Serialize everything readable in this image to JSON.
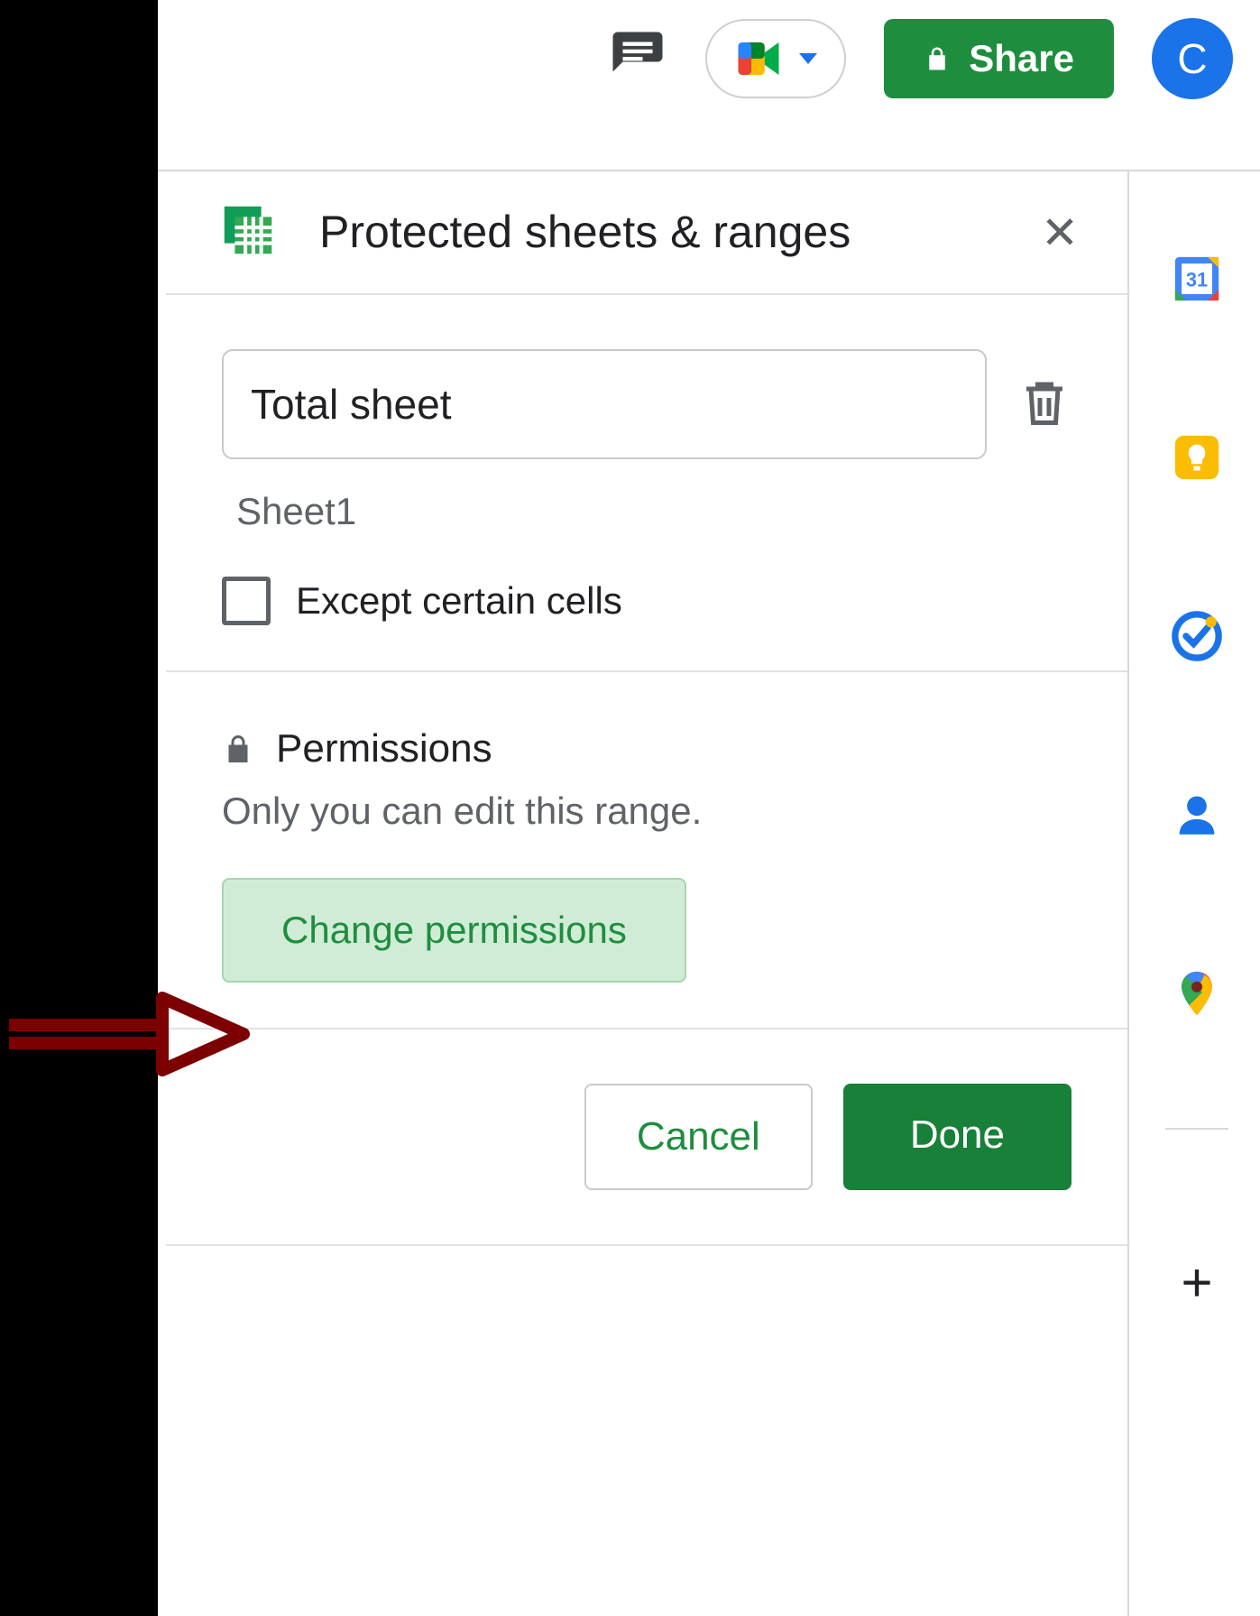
{
  "topbar": {
    "share_label": "Share",
    "avatar_initial": "C"
  },
  "panel": {
    "title": "Protected sheets & ranges",
    "protection_name": "Total sheet",
    "sub_sheet_label": "Sheet1",
    "except_cells_label": "Except certain cells",
    "permissions_heading": "Permissions",
    "permissions_desc": "Only you can edit this range.",
    "change_permissions_label": "Change permissions",
    "cancel_label": "Cancel",
    "done_label": "Done"
  },
  "rightrail": {
    "calendar_day": "31"
  }
}
